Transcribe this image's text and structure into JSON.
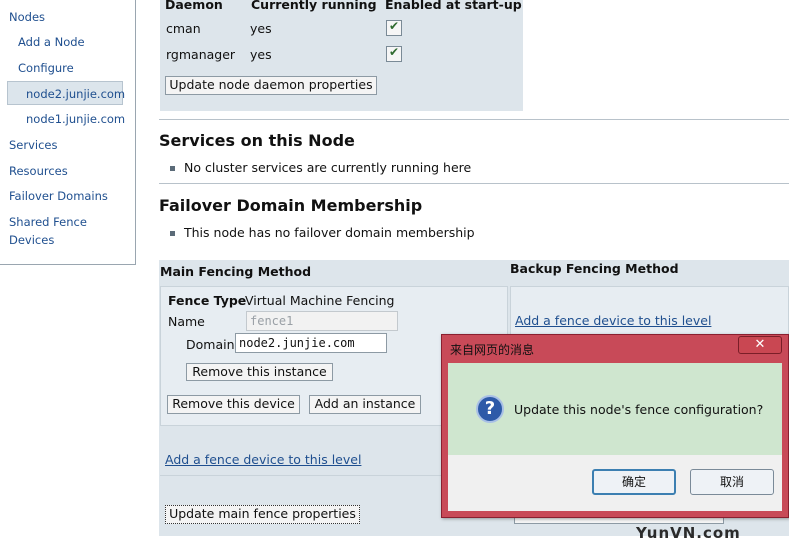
{
  "sidebar": {
    "items": [
      {
        "label": "Nodes"
      },
      {
        "label": "Add a Node"
      },
      {
        "label": "Configure"
      },
      {
        "label": "node2.junjie.com"
      },
      {
        "label": "node1.junjie.com"
      },
      {
        "label": "Services"
      },
      {
        "label": "Resources"
      },
      {
        "label": "Failover Domains"
      },
      {
        "label": "Shared Fence"
      },
      {
        "label": "Devices"
      }
    ]
  },
  "daemons": {
    "headers": [
      "Daemon",
      "Currently running",
      "Enabled at start-up"
    ],
    "rows": [
      {
        "name": "cman",
        "running": "yes",
        "enabled": true
      },
      {
        "name": "rgmanager",
        "running": "yes",
        "enabled": true
      }
    ],
    "update_button": "Update node daemon properties"
  },
  "services": {
    "title": "Services on this Node",
    "message": "No cluster services are currently running here"
  },
  "failover": {
    "title": "Failover Domain Membership",
    "message": "This node has no failover domain membership"
  },
  "fencing": {
    "main_title": "Main Fencing Method",
    "backup_title": "Backup Fencing Method",
    "fence_type_label": "Fence Type",
    "fence_type_value": "Virtual Machine Fencing",
    "name_label": "Name",
    "name_value": "fence1",
    "domain_label": "Domain",
    "domain_value": "node2.junjie.com",
    "remove_instance": "Remove this instance",
    "remove_device": "Remove this device",
    "add_instance": "Add an instance",
    "add_device_main": "Add a fence device to this level",
    "add_device_backup": "Add a fence device to this level",
    "update_main": "Update main fence properties"
  },
  "dialog": {
    "title": "来自网页的消息",
    "message": "Update this node's fence configuration?",
    "ok": "确定",
    "cancel": "取消",
    "close": "✕"
  },
  "watermark": "YunVN.com",
  "colors": {
    "link": "#1f4f8f",
    "panel": "#dde5eb",
    "dialog_frame": "#c84a58",
    "dialog_body": "#cfe6cf"
  }
}
